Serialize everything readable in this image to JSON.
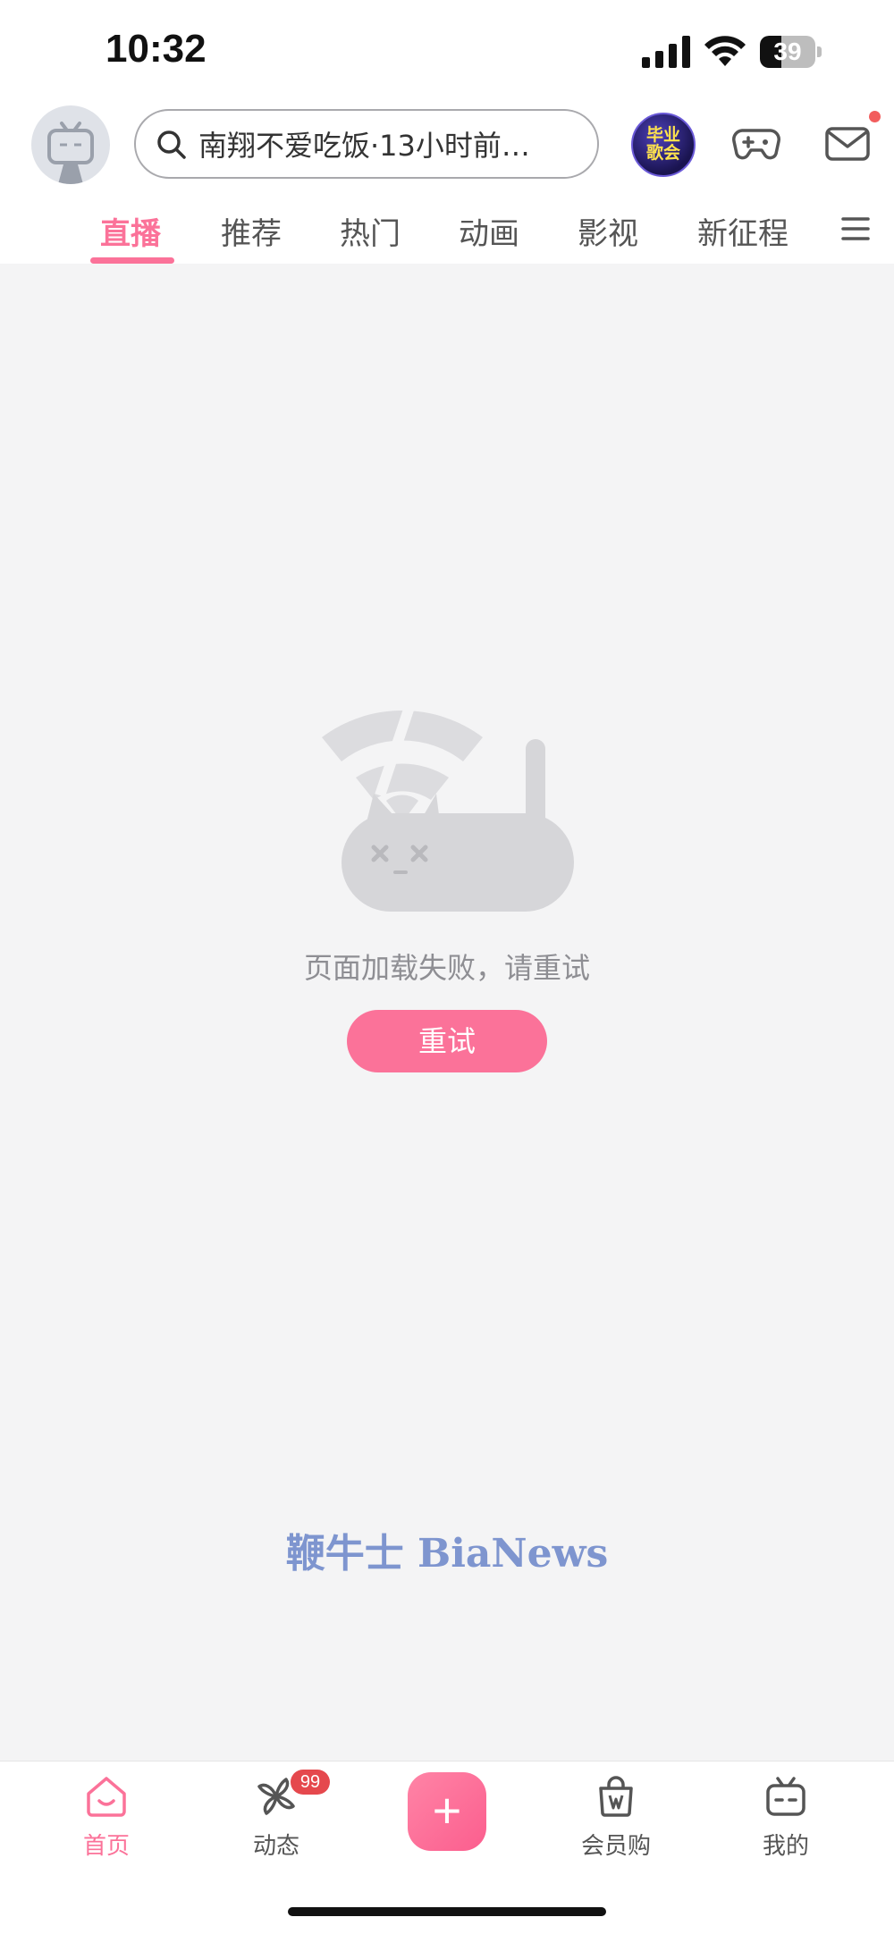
{
  "status_bar": {
    "time": "10:32",
    "battery": "39",
    "battery_level": 0.39
  },
  "header": {
    "search_text": "南翔不爱吃饭·13小时前…",
    "badge_line1": "毕业",
    "badge_line2": "歌会"
  },
  "tabs": [
    {
      "label": "直播",
      "active": true
    },
    {
      "label": "推荐",
      "active": false
    },
    {
      "label": "热门",
      "active": false
    },
    {
      "label": "动画",
      "active": false
    },
    {
      "label": "影视",
      "active": false
    },
    {
      "label": "新征程",
      "active": false
    }
  ],
  "error": {
    "message": "页面加载失败，请重试",
    "retry_label": "重试"
  },
  "watermark": "鞭牛士 BiaNews",
  "bottom_nav": {
    "home": "首页",
    "dynamic": "动态",
    "dynamic_badge": "99",
    "publish": "+",
    "mall": "会员购",
    "mine": "我的"
  },
  "colors": {
    "accent": "#fb7299",
    "background": "#f4f4f5",
    "badge_red": "#e5484d"
  }
}
